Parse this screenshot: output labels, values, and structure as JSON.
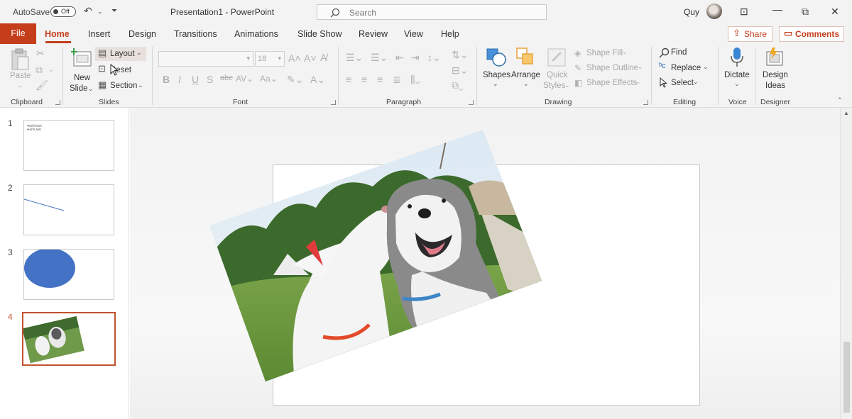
{
  "titlebar": {
    "autosave_label": "AutoSave",
    "autosave_state": "Off",
    "document_title": "Presentation1  -  PowerPoint",
    "search_placeholder": "Search",
    "user_name": "Quy"
  },
  "tabs": {
    "file": "File",
    "items": [
      "Home",
      "Insert",
      "Design",
      "Transitions",
      "Animations",
      "Slide Show",
      "Review",
      "View",
      "Help"
    ],
    "share": "Share",
    "comments": "Comments"
  },
  "ribbon": {
    "clipboard": {
      "paste": "Paste",
      "label": "Clipboard"
    },
    "slides": {
      "new_slide_1": "New",
      "new_slide_2": "Slide",
      "layout": "Layout",
      "reset": "Reset",
      "section": "Section",
      "label": "Slides"
    },
    "font": {
      "size": "18",
      "label": "Font"
    },
    "paragraph": {
      "label": "Paragraph"
    },
    "drawing": {
      "shapes": "Shapes",
      "arrange": "Arrange",
      "quick_styles_1": "Quick",
      "quick_styles_2": "Styles",
      "shape_fill": "Shape Fill",
      "shape_outline": "Shape Outline",
      "shape_effects": "Shape Effects",
      "label": "Drawing"
    },
    "editing": {
      "find": "Find",
      "replace": "Replace",
      "select": "Select",
      "label": "Editing"
    },
    "voice": {
      "dictate": "Dictate",
      "label": "Voice"
    },
    "designer": {
      "design_ideas_1": "Design",
      "design_ideas_2": "Ideas",
      "label": "Designer"
    }
  },
  "slides": [
    {
      "number": "1",
      "bullets": [
        "•Khối hình",
        "•Hình ảnh"
      ]
    },
    {
      "number": "2"
    },
    {
      "number": "3"
    },
    {
      "number": "4",
      "selected": true
    }
  ],
  "colors": {
    "accent": "#c43e1c",
    "shape_blue": "#4472c4"
  }
}
